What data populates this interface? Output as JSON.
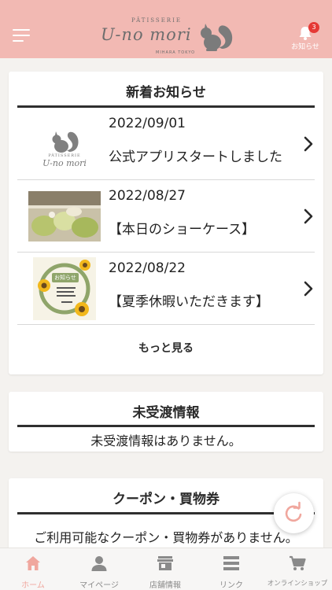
{
  "header": {
    "logo_sub": "PÂTISSERIE",
    "logo_main": "U-no mori",
    "logo_bottom": "MIHARA TOKYO",
    "notification_count": "3",
    "notification_label": "お知らせ",
    "accent": "#f2b9b3"
  },
  "news": {
    "title": "新着お知らせ",
    "items": [
      {
        "date": "2022/09/01",
        "text": "公式アプリスタートしました",
        "thumb": "logo-thumbnail",
        "thumb_sub": "PÂTISSERIE",
        "thumb_main": "U-no mori"
      },
      {
        "date": "2022/08/27",
        "text": "【本日のショーケース】",
        "thumb": "showcase-photo"
      },
      {
        "date": "2022/08/22",
        "text": "【夏季休暇いただきます】",
        "thumb": "sunflower-notice",
        "thumb_badge": "お知らせ"
      }
    ],
    "more_label": "もっと見る"
  },
  "pending": {
    "title": "未受渡情報",
    "message": "未受渡情報はありません。"
  },
  "coupon": {
    "title": "クーポン・買物券",
    "message": "ご利用可能なクーポン・買物券がありません。"
  },
  "tabs": [
    {
      "label": "ホーム",
      "icon": "home-icon",
      "active": true
    },
    {
      "label": "マイページ",
      "icon": "person-icon",
      "active": false
    },
    {
      "label": "店舗情報",
      "icon": "store-icon",
      "active": false
    },
    {
      "label": "リンク",
      "icon": "list-icon",
      "active": false
    },
    {
      "label": "オンラインショップ",
      "icon": "cart-icon",
      "active": false
    }
  ]
}
